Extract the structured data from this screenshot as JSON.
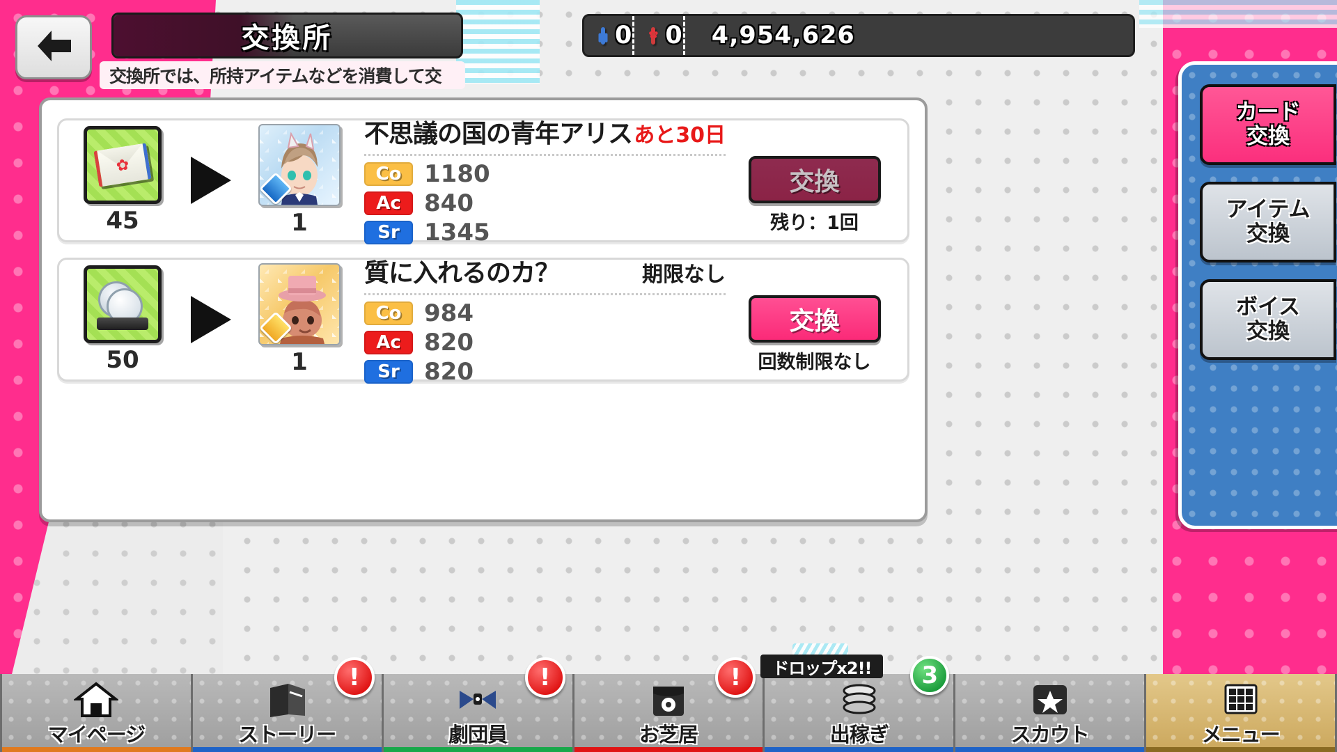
{
  "header": {
    "back_icon": "arrow-left-icon",
    "title": "交換所",
    "subtitle": "交換所では、所持アイテムなどを消費して交",
    "currencies": [
      {
        "icon": "blue-envelope-icon",
        "value": "0"
      },
      {
        "icon": "red-envelope-icon",
        "value": "0"
      },
      {
        "icon": "gold-coin-icon",
        "value": "4,954,626"
      }
    ]
  },
  "sidebar": {
    "tabs": [
      {
        "line1": "カード",
        "line2": "交換",
        "active": true
      },
      {
        "line1": "アイテム",
        "line2": "交換",
        "active": false
      },
      {
        "line1": "ボイス",
        "line2": "交換",
        "active": false
      }
    ]
  },
  "exchange_list": [
    {
      "cost_icon": "green-letter-card-icon",
      "cost_qty": "45",
      "arrow_icon": "arrow-right-icon",
      "reward_icon": "alice-boy-card-icon",
      "reward_attribute": "blue-water-gem",
      "reward_qty": "1",
      "card_name": "不思議の国の青年アリス",
      "limit_label": "あと30日",
      "limit_style": "red",
      "stats": [
        {
          "tag": "Co",
          "value": "1180"
        },
        {
          "tag": "Ac",
          "value": "840"
        },
        {
          "tag": "Sr",
          "value": "1345"
        }
      ],
      "button_label": "交換",
      "button_state": "disabled",
      "remaining_label": "残り：1回"
    },
    {
      "cost_icon": "green-medal-card-icon",
      "cost_qty": "50",
      "arrow_icon": "arrow-right-icon",
      "reward_icon": "top-hat-card-icon",
      "reward_attribute": "yellow-star-gem",
      "reward_qty": "1",
      "card_name": "質に入れるのカ？",
      "limit_label": "期限なし",
      "limit_style": "black",
      "stats": [
        {
          "tag": "Co",
          "value": "984"
        },
        {
          "tag": "Ac",
          "value": "820"
        },
        {
          "tag": "Sr",
          "value": "820"
        }
      ],
      "button_label": "交換",
      "button_state": "active",
      "remaining_label": "回数制限なし"
    }
  ],
  "bottom_nav": [
    {
      "label": "マイページ",
      "icon": "home-icon",
      "badge": "",
      "badge_type": "",
      "active": false,
      "underline": "#e07a1f"
    },
    {
      "label": "ストーリー",
      "icon": "book-icon",
      "badge": "!",
      "badge_type": "alert",
      "active": false,
      "underline": "#1f63c7"
    },
    {
      "label": "劇団員",
      "icon": "bowtie-icon",
      "badge": "!",
      "badge_type": "alert",
      "active": false,
      "underline": "#18a84a"
    },
    {
      "label": "お芝居",
      "icon": "theater-icon",
      "badge": "!",
      "badge_type": "alert",
      "active": false,
      "underline": "#e01414"
    },
    {
      "label": "出稼ぎ",
      "icon": "coins-icon",
      "badge": "3",
      "badge_type": "count",
      "banner": "ドロップx2!!",
      "active": false,
      "underline": "#1f63c7"
    },
    {
      "label": "スカウト",
      "icon": "star-icon",
      "badge": "",
      "badge_type": "",
      "active": false,
      "underline": "#1f63c7"
    },
    {
      "label": "メニュー",
      "icon": "grid-icon",
      "badge": "",
      "badge_type": "",
      "active": true,
      "underline": "#8a6a22"
    }
  ],
  "colors": {
    "pink_bg": "#ff2d8d",
    "accent_pink": "#fb2a78",
    "sidebar_blue": "#3f7fc4",
    "disabled_maroon": "#8b2346",
    "stat_co": "#fbbf45",
    "stat_ac": "#ec1c1c",
    "stat_sr": "#1f6fe0",
    "limit_red": "#e81919",
    "menu_gold": "#cba75c"
  }
}
